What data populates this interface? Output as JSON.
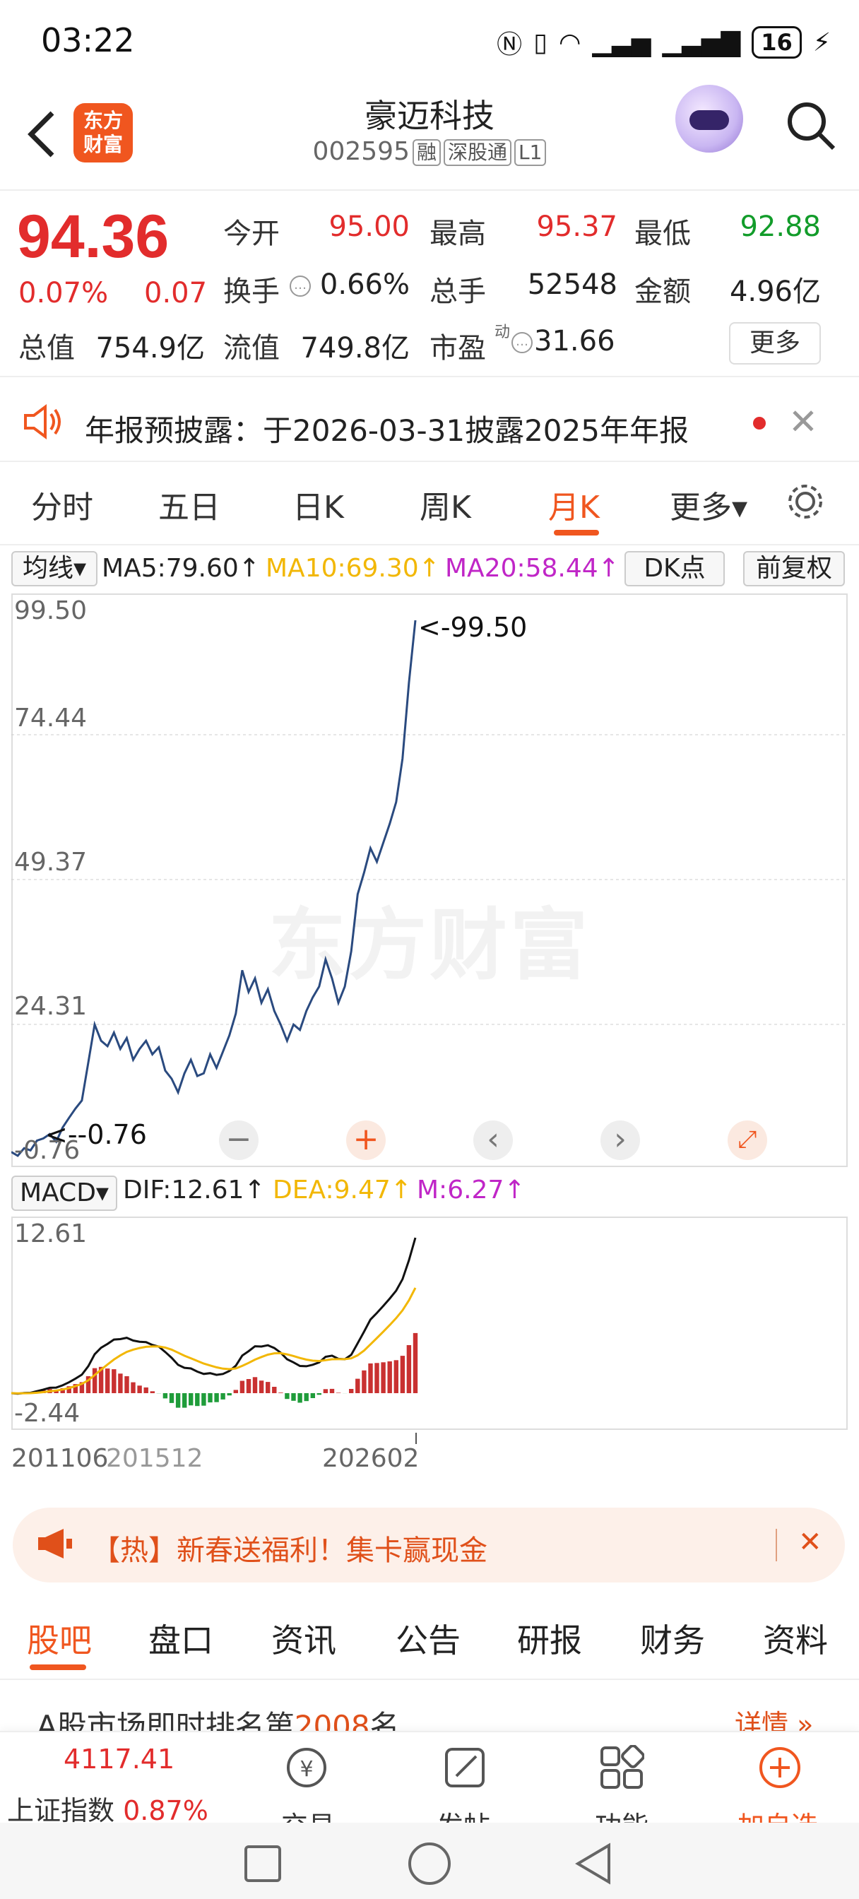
{
  "status": {
    "time": "03:22",
    "battery": "16"
  },
  "header": {
    "title": "豪迈科技",
    "code": "002595",
    "tags": [
      "融",
      "深股通",
      "L1"
    ],
    "logo": "东方\n财富"
  },
  "quote": {
    "price": "94.36",
    "change_pct": "0.07%",
    "change": "0.07",
    "open_label": "今开",
    "open": "95.00",
    "high_label": "最高",
    "high": "95.37",
    "low_label": "最低",
    "low": "92.88",
    "turnover_label": "换手",
    "turnover": "0.66%",
    "volume_label": "总手",
    "volume": "52548",
    "amount_label": "金额",
    "amount": "4.96亿",
    "mcap_label": "总值",
    "mcap": "754.9亿",
    "float_label": "流值",
    "float": "749.8亿",
    "pe_label": "市盈",
    "pe_sup": "动",
    "pe": "31.66",
    "more": "更多"
  },
  "notice": {
    "text": "年报预披露：于2026-03-31披露2025年年报"
  },
  "tabs": [
    "分时",
    "五日",
    "日K",
    "周K",
    "月K",
    "更多▾"
  ],
  "ma": {
    "selector": "均线",
    "ma5": "MA5:79.60↑",
    "ma10": "MA10:69.30↑",
    "ma20": "MA20:58.44↑",
    "dk": "DK点",
    "adjust": "前复权",
    "colors": {
      "ma5": "#222222",
      "ma10": "#f2b705",
      "ma20": "#c026c7"
    }
  },
  "kchart": {
    "y_ticks": [
      "99.50",
      "74.44",
      "49.37",
      "24.31",
      "-0.76"
    ],
    "max_note": "<-99.50",
    "min_note": "<--0.76",
    "watermark": "东方财富"
  },
  "macd": {
    "selector": "MACD",
    "dif": "DIF:12.61↑",
    "dea": "DEA:9.47↑",
    "m": "M:6.27↑",
    "top": "12.61",
    "bottom": "-2.44"
  },
  "dates": [
    "201106",
    "201512",
    "202602"
  ],
  "chart_data": {
    "type": "line",
    "x_start": "2011-06",
    "x_end": "2026-02",
    "ylim": [
      -0.76,
      99.5
    ],
    "values": [
      1.5,
      0.8,
      2.2,
      1.8,
      3.6,
      4.0,
      4.8,
      3.4,
      6.0,
      7.8,
      9.5,
      11.0,
      18.0,
      25.0,
      22.0,
      21.0,
      23.5,
      20.5,
      22.5,
      18.5,
      20.5,
      22.0,
      19.5,
      20.8,
      16.5,
      15.0,
      12.5,
      16.0,
      18.5,
      15.5,
      16.0,
      19.5,
      17.0,
      20.0,
      23.0,
      27.0,
      35.0,
      31.0,
      33.5,
      29.0,
      31.5,
      27.5,
      25.0,
      22.0,
      25.0,
      24.0,
      27.5,
      30.0,
      32.0,
      37.0,
      33.5,
      29.0,
      32.0,
      38.5,
      49.0,
      53.0,
      57.5,
      55.0,
      58.5,
      62.0,
      66.0,
      74.0,
      88.0,
      99.5
    ]
  }
}
